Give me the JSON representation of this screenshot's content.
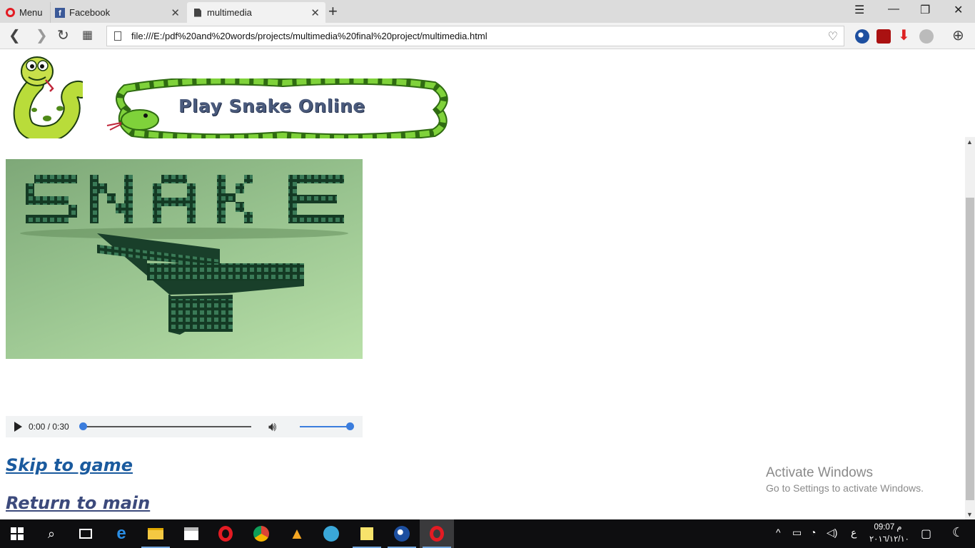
{
  "browser": {
    "tabs": [
      {
        "label": "Menu"
      },
      {
        "label": "Facebook"
      },
      {
        "label": "multimedia"
      }
    ],
    "url": "file:///E:/pdf%20and%20words/projects/multimedia%20final%20project/multimedia.html"
  },
  "page": {
    "banner_title": "Play Snake Online",
    "audio": {
      "time": "0:00 / 0:30",
      "progress": 0.0,
      "volume": 1.0
    },
    "links": {
      "skip": "Skip to game",
      "return": "Return to main"
    }
  },
  "watermark": {
    "line1": "Activate Windows",
    "line2": "Go to Settings to activate Windows."
  },
  "taskbar": {
    "clock_time": "09:07 م",
    "clock_date": "٢٠١٦/١٢/١٠",
    "language": "ع",
    "apps": [
      "start-icon",
      "search-icon",
      "task-view-icon",
      "edge-icon",
      "file-explorer-icon",
      "store-icon",
      "opera-icon",
      "chrome-icon",
      "vlc-icon",
      "video-icon",
      "sticky-notes-icon",
      "eagle-app-icon",
      "opera-active-icon"
    ]
  },
  "colors": {
    "link": "#1a5a9e",
    "accent": "#3b7ddd",
    "opera_red": "#e31b23"
  }
}
